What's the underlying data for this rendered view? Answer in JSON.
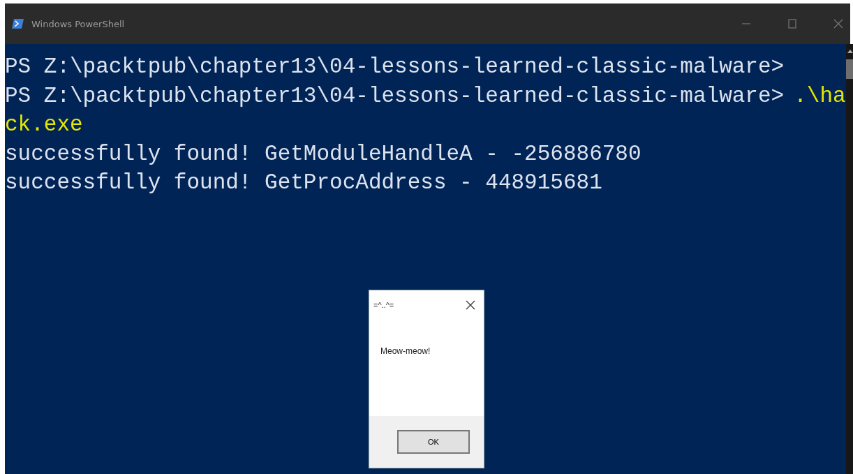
{
  "window": {
    "title": "Windows PowerShell"
  },
  "console_lines": [
    {
      "kind": "prompt",
      "prompt": "PS Z:\\packtpub\\chapter13\\04-lessons-learned-classic-malware>"
    },
    {
      "kind": "prompt",
      "prompt": "PS Z:\\packtpub\\chapter13\\04-lessons-learned-classic-malware>",
      "command": ".\\ha"
    },
    {
      "kind": "command",
      "command": "ck.exe"
    },
    {
      "kind": "output",
      "text": "successfully found! GetModuleHandleA - -256886780"
    },
    {
      "kind": "output",
      "text": "successfully found! GetProcAddress - 448915681"
    }
  ],
  "dialog": {
    "title": "=^..^=",
    "message": "Meow-meow!",
    "button": "OK"
  }
}
